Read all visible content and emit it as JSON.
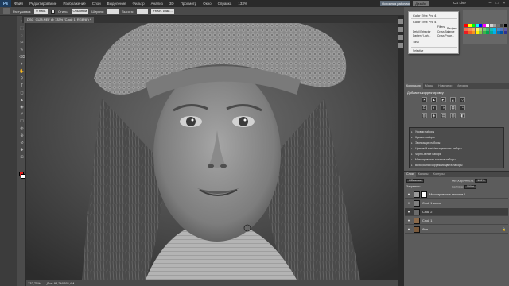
{
  "menubar": {
    "logo": "Ps",
    "items": [
      "Файл",
      "Редактирование",
      "Изображение",
      "Слои",
      "Выделение",
      "Фильтр",
      "Анализ",
      "3D",
      "Просмотр",
      "Окно",
      "Справка"
    ],
    "zoom": "133%",
    "workspace_essentials": "Основная рабочая среда",
    "workspace_design": "Дизайн",
    "cs_live": "CS Live"
  },
  "options": {
    "feather_label": "Растушевка:",
    "feather_value": "0 пикс.",
    "style_label": "Стиль:",
    "style_value": "Обычный",
    "width_label": "Ширина:",
    "height_label": "Высота:",
    "refine_label": "Уточн. край..."
  },
  "document": {
    "tab_title": "DSC_0128.NEF @ 133% (Слой 1, RGB/8*) *"
  },
  "status": {
    "zoom": "132,75%",
    "doc_size": "Док: 98,2M/293,4M"
  },
  "efex": {
    "title": "Color Efex Pro 4",
    "title2": "Color Efex Pro 4",
    "rows": [
      "Filters",
      "Recipes",
      "Detail Extractor",
      "Cross Balance",
      "Darken / Ligh...",
      "Cross Proce...",
      "Tonal"
    ],
    "footer": "Selective"
  },
  "corrections": {
    "tabs": [
      "Коррекция",
      "Маски",
      "Навигатор",
      "История"
    ],
    "heading": "Добавить корректировку",
    "icons": [
      "☀",
      "▲",
      "◩",
      "◭",
      "▽",
      "⚖",
      "◐",
      "◑",
      "▦",
      "◔",
      "▨",
      "◈",
      "▤",
      "▧",
      "◧"
    ],
    "presets": [
      "Уровни наборы",
      "Кривые наборы",
      "Экспозиция наборы",
      "Цветовой тон/Насыщенность наборы",
      "Черно-белое наборы",
      "Микширование каналов наборы",
      "Выборочная коррекция цвета наборы"
    ]
  },
  "layers": {
    "tabs": [
      "Слои",
      "Каналы",
      "Контуры"
    ],
    "blend_mode": "Обычные",
    "opacity_label": "Непрозрачность:",
    "opacity_value": "100%",
    "lock_label": "Закрепить:",
    "fill_label": "Заливка:",
    "fill_value": "100%",
    "items": [
      {
        "name": "Микширование каналов 1",
        "thumb": "#9a9a9a",
        "has_mask": true,
        "selected": false,
        "locked": false
      },
      {
        "name": "Слой 1 копия",
        "thumb": "#7e7e7e",
        "has_mask": false,
        "selected": false,
        "locked": false
      },
      {
        "name": "Слой 2",
        "thumb": "#6b6b6b",
        "has_mask": false,
        "selected": true,
        "locked": false
      },
      {
        "name": "Слой 1",
        "thumb": "#8c6a4a",
        "has_mask": false,
        "selected": false,
        "locked": false
      },
      {
        "name": "Фон",
        "thumb": "#7a5a3c",
        "has_mask": false,
        "selected": false,
        "locked": true
      }
    ]
  },
  "tools": [
    "↖",
    "⬚",
    "◌",
    "✂",
    "✎",
    "⌫",
    "✦",
    "✋",
    "⚲",
    "T",
    "◻",
    "▲",
    "◉",
    "✐",
    "☐",
    "◍",
    "⊕",
    "⊘",
    "✱",
    "⊞"
  ],
  "colors": {
    "foreground": "#e01a1a",
    "background": "#ffffff",
    "accent_workspace": "#5e6a77"
  }
}
